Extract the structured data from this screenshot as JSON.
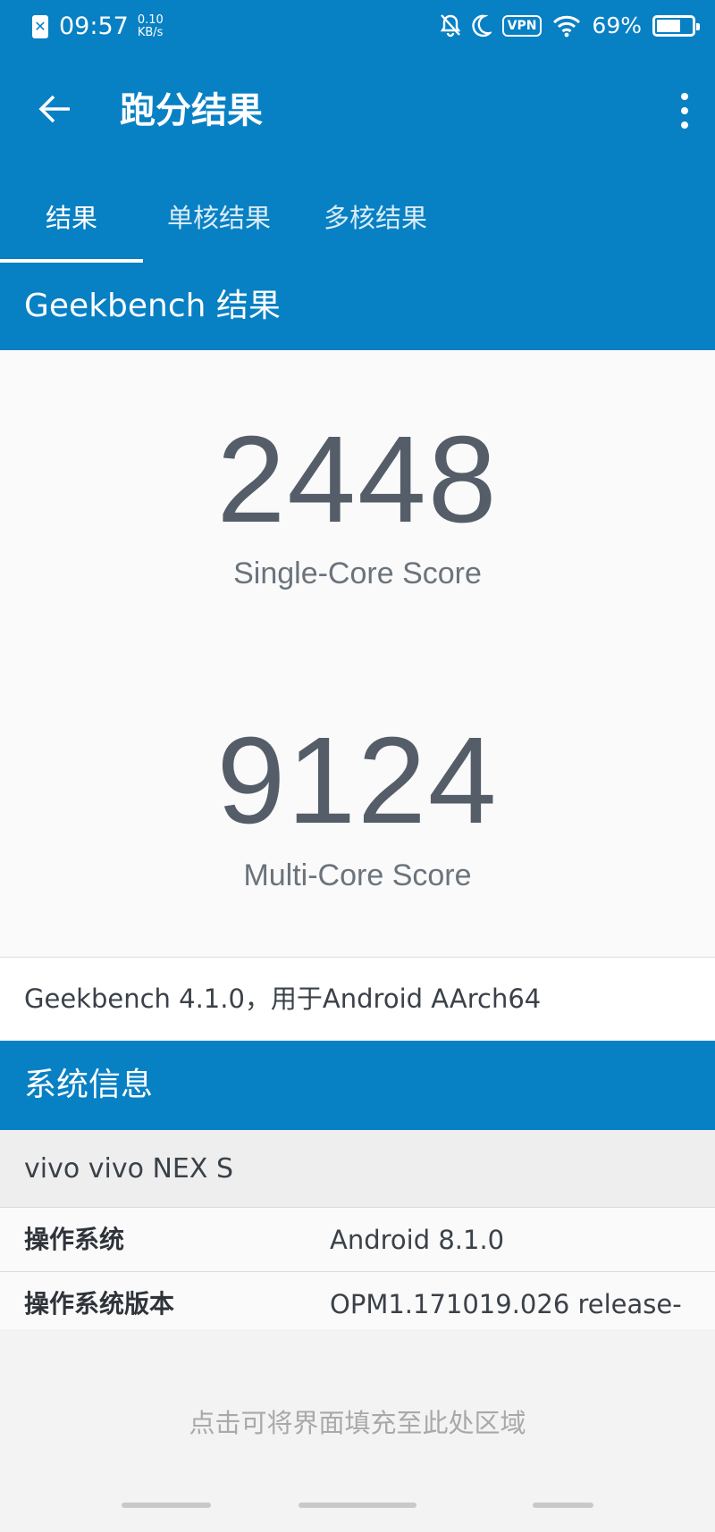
{
  "status_bar": {
    "time": "09:57",
    "net_speed_value": "0.10",
    "net_speed_unit": "KB/s",
    "vpn": "VPN",
    "battery_percent": "69%",
    "battery_level": 0.69
  },
  "app_bar": {
    "title": "跑分结果"
  },
  "tabs": [
    {
      "label": "结果",
      "active": true
    },
    {
      "label": "单核结果",
      "active": false
    },
    {
      "label": "多核结果",
      "active": false
    }
  ],
  "geekbench_section": {
    "header": "Geekbench 结果",
    "single_core_score": "2448",
    "single_core_label": "Single-Core Score",
    "multi_core_score": "9124",
    "multi_core_label": "Multi-Core Score",
    "version_text": "Geekbench 4.1.0，用于Android AArch64"
  },
  "system_info": {
    "header": "系统信息",
    "device": "vivo vivo NEX S",
    "rows": [
      {
        "key": "操作系统",
        "value": "Android 8.1.0"
      },
      {
        "key": "操作系统版本",
        "value": "OPM1.171019.026 release-"
      }
    ]
  },
  "overlay": {
    "fill_hint": "点击可将界面填充至此处区域"
  },
  "colors": {
    "primary": "#0880c4",
    "score_text": "#555e68"
  }
}
